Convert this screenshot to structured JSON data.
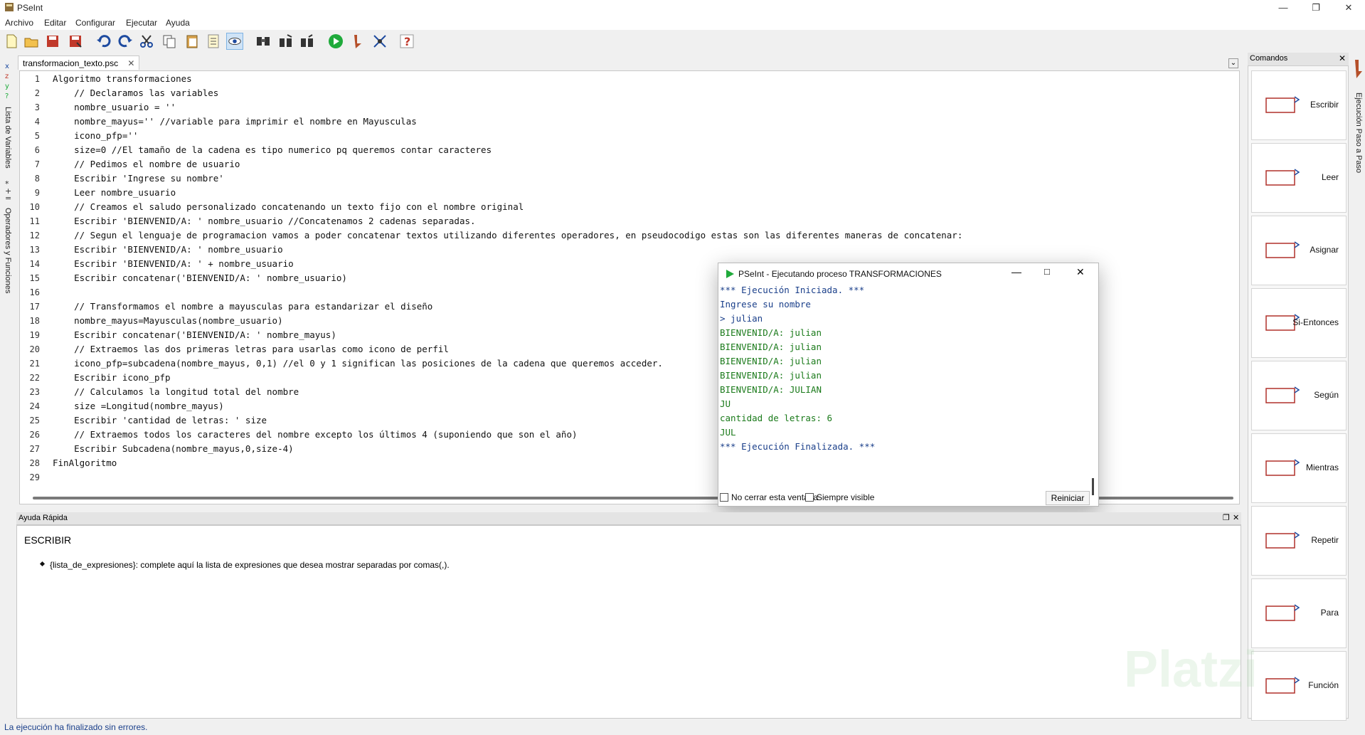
{
  "window": {
    "title": "PSeInt"
  },
  "menu": [
    "Archivo",
    "Editar",
    "Configurar",
    "Ejecutar",
    "Ayuda"
  ],
  "toolbar_icons": [
    "new-file-icon",
    "open-folder-icon",
    "save-icon",
    "save-as-icon",
    "undo-icon",
    "redo-icon",
    "cut-icon",
    "copy-icon",
    "paste-icon",
    "list-icon",
    "view-icon",
    "search-icon",
    "replace-icon",
    "comment-icon",
    "run-icon",
    "step-icon",
    "debug-icon",
    "help-icon"
  ],
  "left_panel": {
    "variables_label": "Lista de Variables",
    "operators_label": "Operadores y Funciones"
  },
  "editor": {
    "tab_label": "transformacion_texto.psc",
    "lines": [
      "Algoritmo transformaciones",
      "    // Declaramos las variables",
      "    nombre_usuario = ''",
      "    nombre_mayus='' //variable para imprimir el nombre en Mayusculas",
      "    icono_pfp=''",
      "    size=0 //El tamaño de la cadena es tipo numerico pq queremos contar caracteres",
      "    // Pedimos el nombre de usuario",
      "    Escribir 'Ingrese su nombre'",
      "    Leer nombre_usuario",
      "    // Creamos el saludo personalizado concatenando un texto fijo con el nombre original",
      "    Escribir 'BIENVENID/A: ' nombre_usuario //Concatenamos 2 cadenas separadas.",
      "    // Segun el lenguaje de programacion vamos a poder concatenar textos utilizando diferentes operadores, en pseudocodigo estas son las diferentes maneras de concatenar:",
      "    Escribir 'BIENVENID/A: ' nombre_usuario",
      "    Escribir 'BIENVENID/A: ' + nombre_usuario",
      "    Escribir concatenar('BIENVENID/A: ' nombre_usuario)",
      "",
      "    // Transformamos el nombre a mayusculas para estandarizar el diseño",
      "    nombre_mayus=Mayusculas(nombre_usuario)",
      "    Escribir concatenar('BIENVENID/A: ' nombre_mayus)",
      "    // Extraemos las dos primeras letras para usarlas como icono de perfil",
      "    icono_pfp=subcadena(nombre_mayus, 0,1) //el 0 y 1 significan las posiciones de la cadena que queremos acceder.",
      "    Escribir icono_pfp",
      "    // Calculamos la longitud total del nombre",
      "    size =Longitud(nombre_mayus)",
      "    Escribir 'cantidad de letras: ' size",
      "    // Extraemos todos los caracteres del nombre excepto los últimos 4 (suponiendo que son el año)",
      "    Escribir Subcadena(nombre_mayus,0,size-4)",
      "FinAlgoritmo",
      ""
    ]
  },
  "exec_dialog": {
    "title": "PSeInt - Ejecutando proceso TRANSFORMACIONES",
    "output": [
      "*** Ejecución Iniciada. ***",
      "Ingrese su nombre",
      "> julian",
      "BIENVENID/A: julian",
      "BIENVENID/A: julian",
      "BIENVENID/A: julian",
      "BIENVENID/A: julian",
      "BIENVENID/A: JULIAN",
      "JU",
      "cantidad de letras: 6",
      "JUL",
      "*** Ejecución Finalizada. ***"
    ],
    "no_close_label": "No cerrar esta ventana",
    "always_visible_label": "Siempre visible",
    "restart_label": "Reiniciar"
  },
  "help": {
    "header": "Ayuda Rápida",
    "title": "ESCRIBIR",
    "bullet": "{lista_de_expresiones}: complete aquí la lista de expresiones que desea mostrar separadas por comas(,)."
  },
  "status": "La ejecución ha finalizado sin errores.",
  "commands": {
    "header": "Comandos",
    "items": [
      "Escribir",
      "Leer",
      "Asignar",
      "Si-Entonces",
      "Según",
      "Mientras",
      "Repetir",
      "Para",
      "Función"
    ],
    "step_label": "Ejecución Paso a Paso"
  },
  "watermark": "Platzi"
}
